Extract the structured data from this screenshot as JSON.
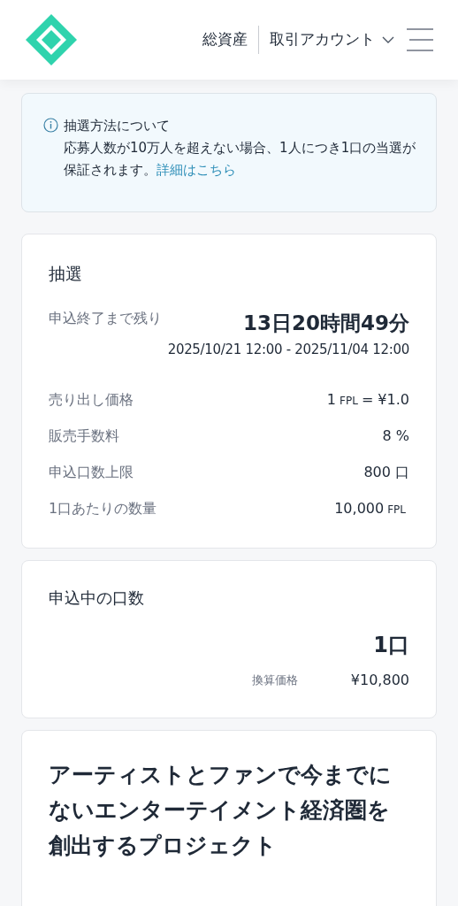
{
  "header": {
    "nav": [
      {
        "label": "総資産",
        "kind": "link"
      },
      {
        "label": "取引アカウント",
        "kind": "dropdown"
      }
    ]
  },
  "notice": {
    "title": "抽選方法について",
    "body": "応募人数が10万人を超えない場合、1人につき1口の当選が保証されます。",
    "link": "詳細はこちら"
  },
  "lottery": {
    "title": "抽選",
    "remaining_label": "申込終了まで残り",
    "remaining": "13日20時間49分",
    "period": "2025/10/21 12:00 - 2025/11/04 12:00",
    "rows": [
      {
        "label": "売り出し価格",
        "value": [
          {
            "text": "1",
            "kind": "num"
          },
          {
            "text": "FPL",
            "kind": "unit"
          },
          {
            "text": "= ¥1.0",
            "kind": "num"
          }
        ]
      },
      {
        "label": "販売手数料",
        "value": [
          {
            "text": "8 %",
            "kind": "num"
          }
        ]
      },
      {
        "label": "申込口数上限",
        "value": [
          {
            "text": "800 口",
            "kind": "num"
          }
        ]
      },
      {
        "label": "1口あたりの数量",
        "value": [
          {
            "text": "10,000",
            "kind": "num"
          },
          {
            "text": "FPL",
            "kind": "unit"
          }
        ]
      }
    ]
  },
  "applied": {
    "title": "申込中の口数",
    "count": "1口",
    "converted_label": "換算価格",
    "converted": "¥10,800"
  },
  "project": {
    "title": "アーティストとファンで今までにないエンターテイメント経済圏を創出するプロジェクト"
  }
}
